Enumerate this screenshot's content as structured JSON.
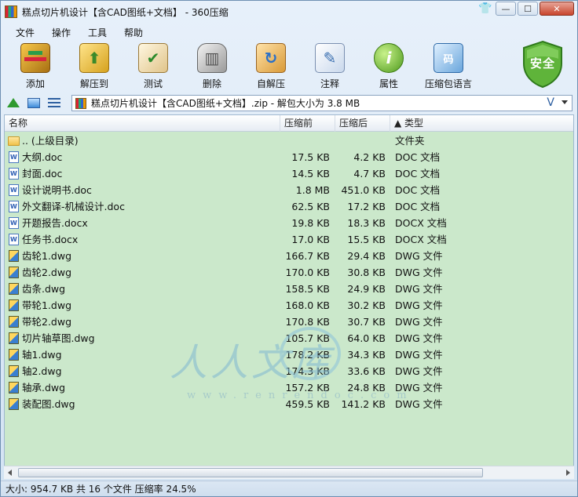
{
  "window": {
    "title": "糕点切片机设计【含CAD图纸+文档】 - 360压缩",
    "controls": {
      "skin": "👕",
      "min": "—",
      "max": "☐",
      "close": "✕"
    }
  },
  "menu": [
    "文件",
    "操作",
    "工具",
    "帮助"
  ],
  "toolbar": {
    "buttons": [
      {
        "label": "添加",
        "icon": "add-archive-icon"
      },
      {
        "label": "解压到",
        "icon": "extract-icon"
      },
      {
        "label": "测试",
        "icon": "test-icon"
      },
      {
        "label": "删除",
        "icon": "delete-icon"
      },
      {
        "label": "自解压",
        "icon": "self-extract-icon"
      },
      {
        "label": "注释",
        "icon": "comment-icon"
      },
      {
        "label": "属性",
        "icon": "properties-icon"
      },
      {
        "label": "压缩包语言",
        "icon": "archive-language-icon"
      }
    ],
    "security_badge": "安全"
  },
  "address": {
    "path": "糕点切片机设计【含CAD图纸+文档】.zip - 解包大小为 3.8 MB"
  },
  "columns": {
    "name": "名称",
    "size": "压缩前",
    "packed": "压缩后",
    "type": "▲ 类型"
  },
  "files": [
    {
      "name": ".. (上级目录)",
      "size": "",
      "packed": "",
      "type": "文件夹",
      "kind": "folder"
    },
    {
      "name": "大纲.doc",
      "size": "17.5 KB",
      "packed": "4.2 KB",
      "type": "DOC 文档",
      "kind": "doc"
    },
    {
      "name": "封面.doc",
      "size": "14.5 KB",
      "packed": "4.7 KB",
      "type": "DOC 文档",
      "kind": "doc"
    },
    {
      "name": "设计说明书.doc",
      "size": "1.8 MB",
      "packed": "451.0 KB",
      "type": "DOC 文档",
      "kind": "doc"
    },
    {
      "name": "外文翻译-机械设计.doc",
      "size": "62.5 KB",
      "packed": "17.2 KB",
      "type": "DOC 文档",
      "kind": "doc"
    },
    {
      "name": "开题报告.docx",
      "size": "19.8 KB",
      "packed": "18.3 KB",
      "type": "DOCX 文档",
      "kind": "doc"
    },
    {
      "name": "任务书.docx",
      "size": "17.0 KB",
      "packed": "15.5 KB",
      "type": "DOCX 文档",
      "kind": "doc"
    },
    {
      "name": "齿轮1.dwg",
      "size": "166.7 KB",
      "packed": "29.4 KB",
      "type": "DWG 文件",
      "kind": "dwg"
    },
    {
      "name": "齿轮2.dwg",
      "size": "170.0 KB",
      "packed": "30.8 KB",
      "type": "DWG 文件",
      "kind": "dwg"
    },
    {
      "name": "齿条.dwg",
      "size": "158.5 KB",
      "packed": "24.9 KB",
      "type": "DWG 文件",
      "kind": "dwg"
    },
    {
      "name": "带轮1.dwg",
      "size": "168.0 KB",
      "packed": "30.2 KB",
      "type": "DWG 文件",
      "kind": "dwg"
    },
    {
      "name": "带轮2.dwg",
      "size": "170.8 KB",
      "packed": "30.7 KB",
      "type": "DWG 文件",
      "kind": "dwg"
    },
    {
      "name": "切片轴草图.dwg",
      "size": "105.7 KB",
      "packed": "64.0 KB",
      "type": "DWG 文件",
      "kind": "dwg"
    },
    {
      "name": "轴1.dwg",
      "size": "178.2 KB",
      "packed": "34.3 KB",
      "type": "DWG 文件",
      "kind": "dwg"
    },
    {
      "name": "轴2.dwg",
      "size": "174.3 KB",
      "packed": "33.6 KB",
      "type": "DWG 文件",
      "kind": "dwg"
    },
    {
      "name": "轴承.dwg",
      "size": "157.2 KB",
      "packed": "24.8 KB",
      "type": "DWG 文件",
      "kind": "dwg"
    },
    {
      "name": "装配图.dwg",
      "size": "459.5 KB",
      "packed": "141.2 KB",
      "type": "DWG 文件",
      "kind": "dwg"
    }
  ],
  "status": "大小: 954.7 KB 共 16 个文件 压缩率 24.5%",
  "watermark": {
    "text": "人人文库",
    "url": "www.renrendoc.com"
  }
}
